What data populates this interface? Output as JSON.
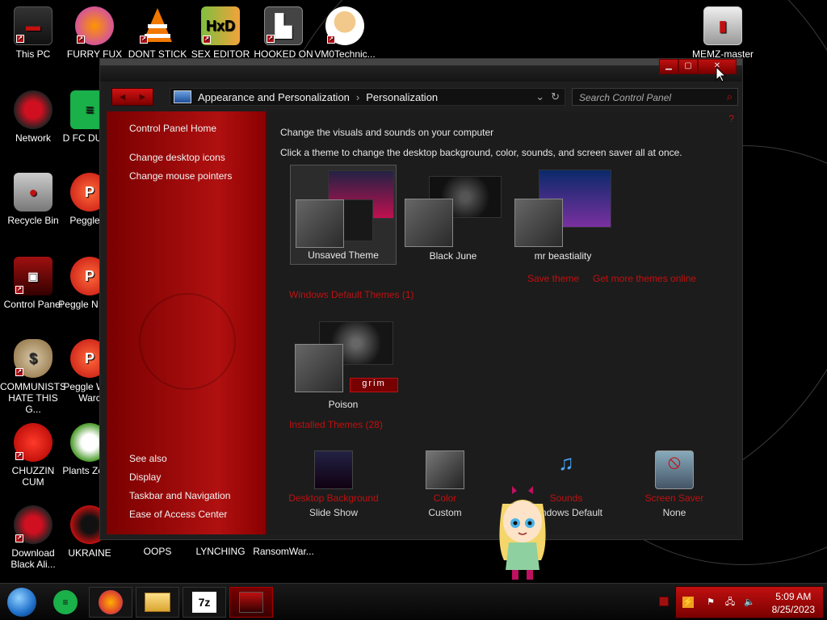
{
  "desktop": {
    "icons_top": [
      {
        "label": "This PC"
      },
      {
        "label": "FURRY FUX"
      },
      {
        "label": "DONT STICK"
      },
      {
        "label": "SEX EDITOR"
      },
      {
        "label": "HOOKED ON"
      },
      {
        "label": "VM0Technic..."
      },
      {
        "label": "MEMZ-master"
      }
    ],
    "icons_left": [
      {
        "label": "Network"
      },
      {
        "label": "Recycle Bin"
      },
      {
        "label": "Control Panel"
      },
      {
        "label": "COMMUNISTS HATE THIS G..."
      },
      {
        "label": "CHUZZIN CUM"
      },
      {
        "label": "Download Black Ali..."
      }
    ],
    "icons_col2": [
      {
        "label": "D FC DUMB"
      },
      {
        "label": "Peggle D"
      },
      {
        "label": "Peggle N Delu"
      },
      {
        "label": "Peggle W of Warc"
      },
      {
        "label": "Plants Zomb"
      },
      {
        "label": "UKRAINE"
      }
    ],
    "icons_bottom": [
      {
        "label": "OOPS"
      },
      {
        "label": "LYNCHING"
      },
      {
        "label": "RansomWar..."
      }
    ]
  },
  "window": {
    "breadcrumb": [
      "Appearance and Personalization",
      "Personalization"
    ],
    "search_placeholder": "Search Control Panel",
    "left_links": [
      "Control Panel Home",
      "Change desktop icons",
      "Change mouse pointers"
    ],
    "see_also_title": "See also",
    "see_also": [
      "Display",
      "Taskbar and Navigation",
      "Ease of Access Center"
    ],
    "heading": "Change the visuals and sounds on your computer",
    "subheading": "Click a theme to change the desktop background, color, sounds, and screen saver all at once.",
    "my_themes": [
      {
        "name": "Unsaved Theme"
      },
      {
        "name": "Black June"
      },
      {
        "name": "mr beastiality"
      }
    ],
    "save_theme": "Save theme",
    "get_more": "Get more themes online",
    "default_section": "Windows Default Themes (1)",
    "default_themes": [
      {
        "name": "Poison"
      }
    ],
    "installed_section": "Installed Themes (28)",
    "bottom": [
      {
        "label": "Desktop Background",
        "value": "Slide Show"
      },
      {
        "label": "Color",
        "value": "Custom"
      },
      {
        "label": "Sounds",
        "value": "Windows Default"
      },
      {
        "label": "Screen Saver",
        "value": "None"
      }
    ],
    "poison_badge": "grim"
  },
  "taskbar": {
    "time": "5:09 AM",
    "date": "8/25/2023",
    "pinned": [
      "start-orb",
      "feed-icon",
      "firefox-icon",
      "file-explorer-icon",
      "7zip-icon",
      "control-panel-icon"
    ]
  },
  "colors": {
    "accent": "#c01010",
    "panel": "#b01010",
    "bg": "#000000"
  }
}
